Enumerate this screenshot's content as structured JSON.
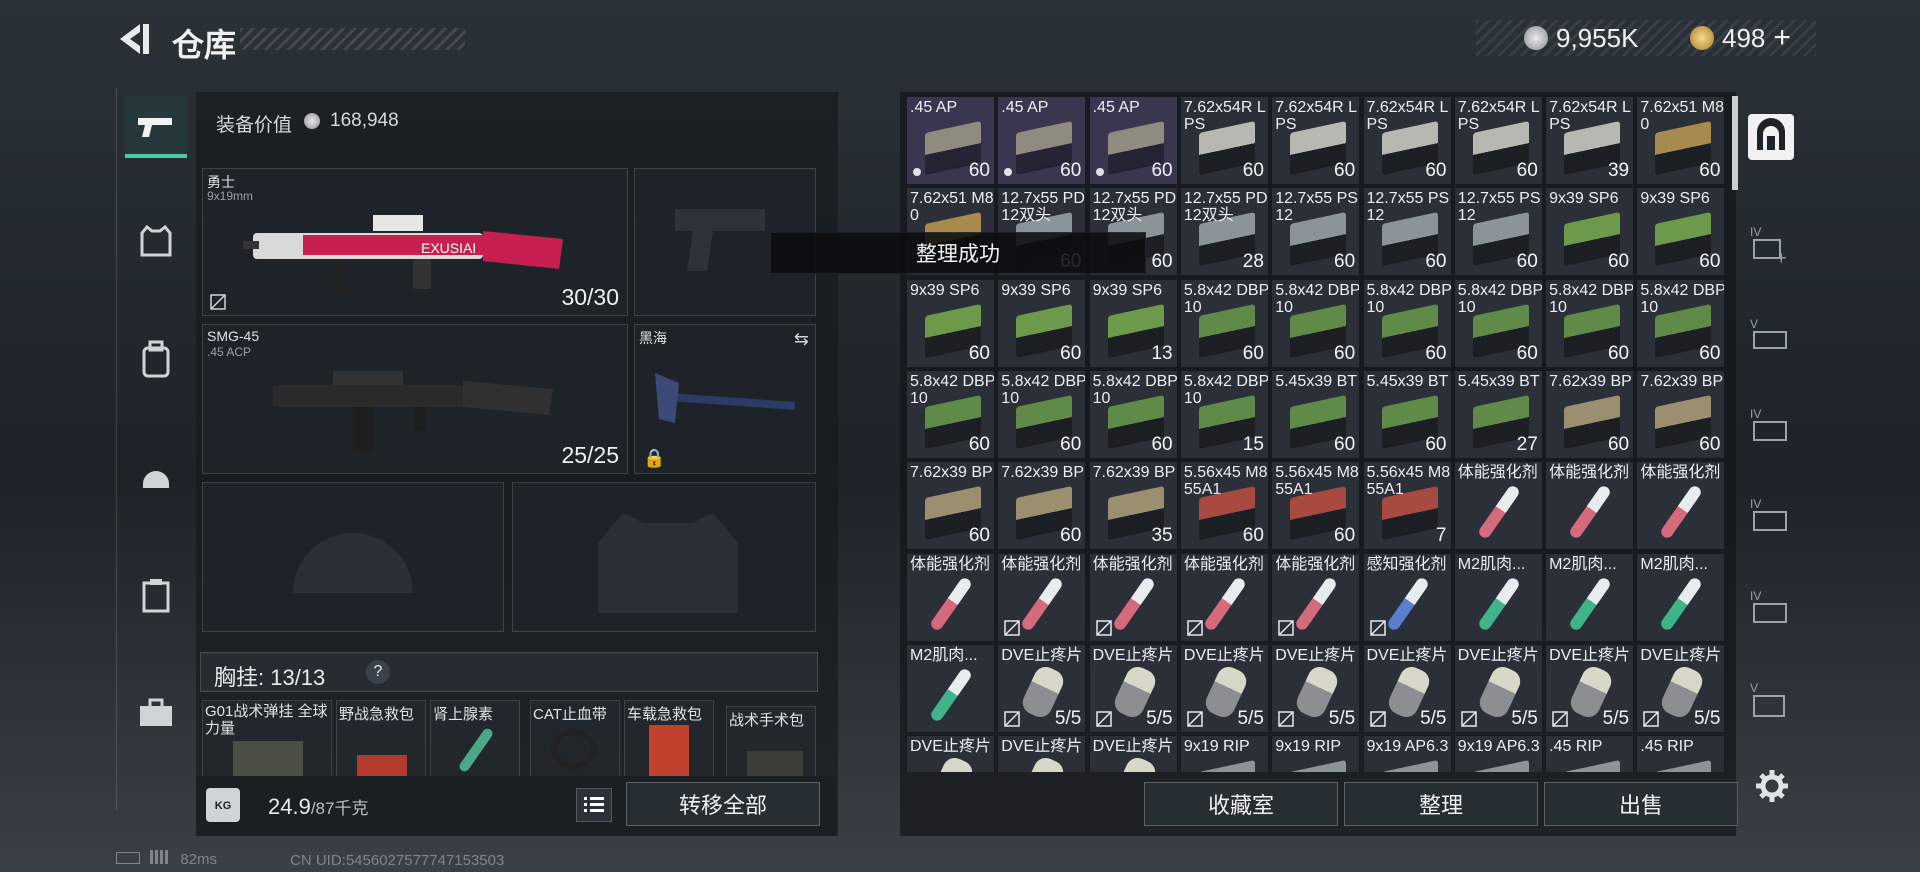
{
  "header": {
    "title": "仓库",
    "currency": [
      {
        "icon": "silver-coin-icon",
        "value": "9,955K"
      },
      {
        "icon": "gold-coin-icon",
        "value": "498"
      }
    ],
    "add_label": "+"
  },
  "categories": [
    "weapons-icon",
    "armor-vest-icon",
    "backpack-icon",
    "helmet-icon",
    "container-icon",
    "toolbox-icon"
  ],
  "equipment": {
    "value_label": "装备价值",
    "value": "168,948",
    "slots": {
      "primary": {
        "name": "勇士",
        "caliber": "9x19mm",
        "ammo": "30/30"
      },
      "secondary": {
        "name": "SMG-45",
        "caliber": ".45 ACP",
        "ammo": "25/25"
      },
      "melee": {
        "name": "黑海"
      }
    },
    "chest_label": "胸挂: 13/13",
    "help_label": "?",
    "quick_items": [
      "G01战术弹挂 全球力量",
      "野战急救包",
      "肾上腺素",
      "CAT止血带",
      "车载急救包",
      "战术手术包"
    ],
    "weight_value": "24.9",
    "weight_capacity": "/87千克",
    "transfer_all_label": "转移全部"
  },
  "toast": "整理成功",
  "stash": {
    "items": [
      {
        "name": ".45 AP",
        "count": "60",
        "kind": "ammo",
        "color": "#8f8b80",
        "dot": true,
        "rarity": "purple"
      },
      {
        "name": ".45 AP",
        "count": "60",
        "kind": "ammo",
        "color": "#8f8b80",
        "dot": true,
        "rarity": "purple"
      },
      {
        "name": ".45 AP",
        "count": "60",
        "kind": "ammo",
        "color": "#8f8b80",
        "dot": true,
        "rarity": "purple"
      },
      {
        "name": "7.62x54R LPS",
        "count": "60",
        "kind": "ammo",
        "color": "#b8b8b2"
      },
      {
        "name": "7.62x54R LPS",
        "count": "60",
        "kind": "ammo",
        "color": "#b8b8b2"
      },
      {
        "name": "7.62x54R LPS",
        "count": "60",
        "kind": "ammo",
        "color": "#b8b8b2"
      },
      {
        "name": "7.62x54R LPS",
        "count": "60",
        "kind": "ammo",
        "color": "#b8b8b2"
      },
      {
        "name": "7.62x54R LPS",
        "count": "39",
        "kind": "ammo",
        "color": "#b8b8b2"
      },
      {
        "name": "7.62x51 M80",
        "count": "60",
        "kind": "ammo",
        "color": "#a88a4e"
      },
      {
        "name": "7.62x51 M80",
        "count": "",
        "kind": "ammo",
        "color": "#a88a4e"
      },
      {
        "name": "12.7x55 PD12双头",
        "count": "60",
        "kind": "ammo",
        "color": "#8b9498"
      },
      {
        "name": "12.7x55 PD12双头",
        "count": "60",
        "kind": "ammo",
        "color": "#8b9498"
      },
      {
        "name": "12.7x55 PD12双头",
        "count": "28",
        "kind": "ammo",
        "color": "#8b9498"
      },
      {
        "name": "12.7x55 PS12",
        "count": "60",
        "kind": "ammo",
        "color": "#8b9498"
      },
      {
        "name": "12.7x55 PS12",
        "count": "60",
        "kind": "ammo",
        "color": "#8b9498"
      },
      {
        "name": "12.7x55 PS12",
        "count": "60",
        "kind": "ammo",
        "color": "#8b9498"
      },
      {
        "name": "9x39 SP6",
        "count": "60",
        "kind": "ammo",
        "color": "#6d9a4a"
      },
      {
        "name": "9x39 SP6",
        "count": "60",
        "kind": "ammo",
        "color": "#6d9a4a"
      },
      {
        "name": "9x39 SP6",
        "count": "60",
        "kind": "ammo",
        "color": "#6d9a4a"
      },
      {
        "name": "9x39 SP6",
        "count": "60",
        "kind": "ammo",
        "color": "#6d9a4a"
      },
      {
        "name": "9x39 SP6",
        "count": "13",
        "kind": "ammo",
        "color": "#6d9a4a"
      },
      {
        "name": "5.8x42 DBP10",
        "count": "60",
        "kind": "ammo",
        "color": "#5f8a48"
      },
      {
        "name": "5.8x42 DBP10",
        "count": "60",
        "kind": "ammo",
        "color": "#5f8a48"
      },
      {
        "name": "5.8x42 DBP10",
        "count": "60",
        "kind": "ammo",
        "color": "#5f8a48"
      },
      {
        "name": "5.8x42 DBP10",
        "count": "60",
        "kind": "ammo",
        "color": "#5f8a48"
      },
      {
        "name": "5.8x42 DBP10",
        "count": "60",
        "kind": "ammo",
        "color": "#5f8a48"
      },
      {
        "name": "5.8x42 DBP10",
        "count": "60",
        "kind": "ammo",
        "color": "#5f8a48"
      },
      {
        "name": "5.8x42 DBP10",
        "count": "60",
        "kind": "ammo",
        "color": "#5f8a48"
      },
      {
        "name": "5.8x42 DBP10",
        "count": "60",
        "kind": "ammo",
        "color": "#5f8a48"
      },
      {
        "name": "5.8x42 DBP10",
        "count": "60",
        "kind": "ammo",
        "color": "#5f8a48"
      },
      {
        "name": "5.8x42 DBP10",
        "count": "15",
        "kind": "ammo",
        "color": "#5f8a48"
      },
      {
        "name": "5.45x39 BT",
        "count": "60",
        "kind": "ammo",
        "color": "#5f8a48"
      },
      {
        "name": "5.45x39 BT",
        "count": "60",
        "kind": "ammo",
        "color": "#5f8a48"
      },
      {
        "name": "5.45x39 BT",
        "count": "27",
        "kind": "ammo",
        "color": "#5f8a48"
      },
      {
        "name": "7.62x39 BP",
        "count": "60",
        "kind": "ammo",
        "color": "#9c8f70"
      },
      {
        "name": "7.62x39 BP",
        "count": "60",
        "kind": "ammo",
        "color": "#9c8f70"
      },
      {
        "name": "7.62x39 BP",
        "count": "60",
        "kind": "ammo",
        "color": "#9c8f70"
      },
      {
        "name": "7.62x39 BP",
        "count": "60",
        "kind": "ammo",
        "color": "#9c8f70"
      },
      {
        "name": "7.62x39 BP",
        "count": "35",
        "kind": "ammo",
        "color": "#9c8f70"
      },
      {
        "name": "5.56x45 M855A1",
        "count": "60",
        "kind": "ammo",
        "color": "#a84a40"
      },
      {
        "name": "5.56x45 M855A1",
        "count": "60",
        "kind": "ammo",
        "color": "#a84a40"
      },
      {
        "name": "5.56x45 M855A1",
        "count": "7",
        "kind": "ammo",
        "color": "#a84a40"
      },
      {
        "name": "体能强化剂",
        "count": "",
        "kind": "injector",
        "color": "#d56a7c"
      },
      {
        "name": "体能强化剂",
        "count": "",
        "kind": "injector",
        "color": "#d56a7c"
      },
      {
        "name": "体能强化剂",
        "count": "",
        "kind": "injector",
        "color": "#d56a7c"
      },
      {
        "name": "体能强化剂",
        "count": "",
        "kind": "injector",
        "color": "#d56a7c"
      },
      {
        "name": "体能强化剂",
        "count": "",
        "kind": "injector",
        "color": "#d56a7c",
        "nodrop": true
      },
      {
        "name": "体能强化剂",
        "count": "",
        "kind": "injector",
        "color": "#d56a7c",
        "nodrop": true
      },
      {
        "name": "体能强化剂",
        "count": "",
        "kind": "injector",
        "color": "#d56a7c",
        "nodrop": true
      },
      {
        "name": "体能强化剂",
        "count": "",
        "kind": "injector",
        "color": "#d56a7c",
        "nodrop": true
      },
      {
        "name": "感知强化剂",
        "count": "",
        "kind": "injector",
        "color": "#5a7fd0",
        "nodrop": true
      },
      {
        "name": "M2肌肉...",
        "count": "",
        "kind": "injector",
        "color": "#3fb48a"
      },
      {
        "name": "M2肌肉...",
        "count": "",
        "kind": "injector",
        "color": "#3fb48a"
      },
      {
        "name": "M2肌肉...",
        "count": "",
        "kind": "injector",
        "color": "#3fb48a"
      },
      {
        "name": "M2肌肉...",
        "count": "",
        "kind": "injector",
        "color": "#3fb48a"
      },
      {
        "name": "DVE止疼片",
        "count": "5/5",
        "kind": "pill",
        "color": "#c9c9b0",
        "nodrop": true
      },
      {
        "name": "DVE止疼片",
        "count": "5/5",
        "kind": "pill",
        "color": "#c9c9b0",
        "nodrop": true
      },
      {
        "name": "DVE止疼片",
        "count": "5/5",
        "kind": "pill",
        "color": "#c9c9b0",
        "nodrop": true
      },
      {
        "name": "DVE止疼片",
        "count": "5/5",
        "kind": "pill",
        "color": "#c9c9b0",
        "nodrop": true
      },
      {
        "name": "DVE止疼片",
        "count": "5/5",
        "kind": "pill",
        "color": "#c9c9b0",
        "nodrop": true
      },
      {
        "name": "DVE止疼片",
        "count": "5/5",
        "kind": "pill",
        "color": "#c9c9b0",
        "nodrop": true
      },
      {
        "name": "DVE止疼片",
        "count": "5/5",
        "kind": "pill",
        "color": "#c9c9b0",
        "nodrop": true
      },
      {
        "name": "DVE止疼片",
        "count": "5/5",
        "kind": "pill",
        "color": "#c9c9b0",
        "nodrop": true
      },
      {
        "name": "DVE止疼片",
        "count": "",
        "kind": "pill",
        "color": "#c9c9b0"
      },
      {
        "name": "DVE止疼片",
        "count": "",
        "kind": "pill",
        "color": "#c9c9b0"
      },
      {
        "name": "DVE止疼片",
        "count": "",
        "kind": "pill",
        "color": "#c9c9b0"
      },
      {
        "name": "9x19 RIP",
        "count": "",
        "kind": "ammo",
        "color": "#8b9498"
      },
      {
        "name": "9x19 RIP",
        "count": "",
        "kind": "ammo",
        "color": "#8b9498"
      },
      {
        "name": "9x19 AP6.3",
        "count": "",
        "kind": "ammo",
        "color": "#8b9498"
      },
      {
        "name": "9x19 AP6.3",
        "count": "",
        "kind": "ammo",
        "color": "#8b9498"
      },
      {
        "name": ".45 RIP",
        "count": "",
        "kind": "ammo",
        "color": "#8b9498"
      },
      {
        "name": ".45 RIP",
        "count": "",
        "kind": "ammo",
        "color": "#8b9498"
      }
    ]
  },
  "bottom_buttons": {
    "collection": "收藏室",
    "sort": "整理",
    "sell": "出售"
  },
  "right_rail": [
    "shelter-icon",
    "add-container-icon",
    "container-icon",
    "container-icon",
    "container-icon",
    "container-icon",
    "container-icon"
  ],
  "settings_icon": "gear-icon",
  "status": {
    "ping": "82ms",
    "uid": "CN UID:5456027577747153503"
  }
}
